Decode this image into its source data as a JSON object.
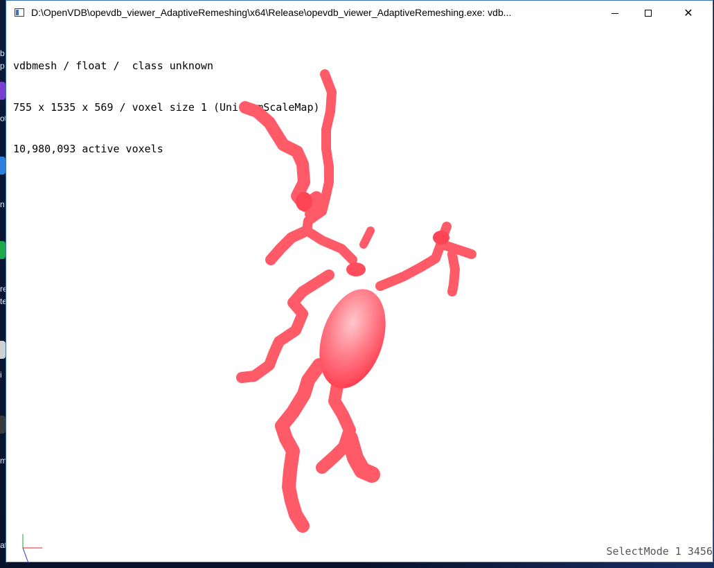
{
  "window": {
    "title": "D:\\OpenVDB\\opevdb_viewer_AdaptiveRemeshing\\x64\\Release\\opevdb_viewer_AdaptiveRemeshing.exe: vdb...",
    "minimize_glyph": "",
    "maximize_glyph": "",
    "close_glyph": "✕"
  },
  "viewport": {
    "info_lines": [
      "vdbmesh / float /  class unknown",
      "755 x 1535 x 569 / voxel size 1 (UniformScaleMap)",
      "10,980,093 active voxels"
    ],
    "status": "SelectMode 1 3456"
  },
  "desktop": {
    "partial_labels": [
      "b",
      "p",
      "ot",
      "n",
      "re",
      "te",
      "i",
      "m",
      "at"
    ]
  },
  "colors": {
    "mesh_light": "#ffc4c8",
    "mesh_mid": "#ff6b78",
    "mesh_dark": "#ff2a3e",
    "axis_x": "#e02020",
    "axis_y": "#20a020",
    "axis_z": "#2030d0"
  },
  "icons": {
    "app": "console-app-icon",
    "minimize": "minimize-icon",
    "maximize": "maximize-icon",
    "close": "close-icon"
  }
}
